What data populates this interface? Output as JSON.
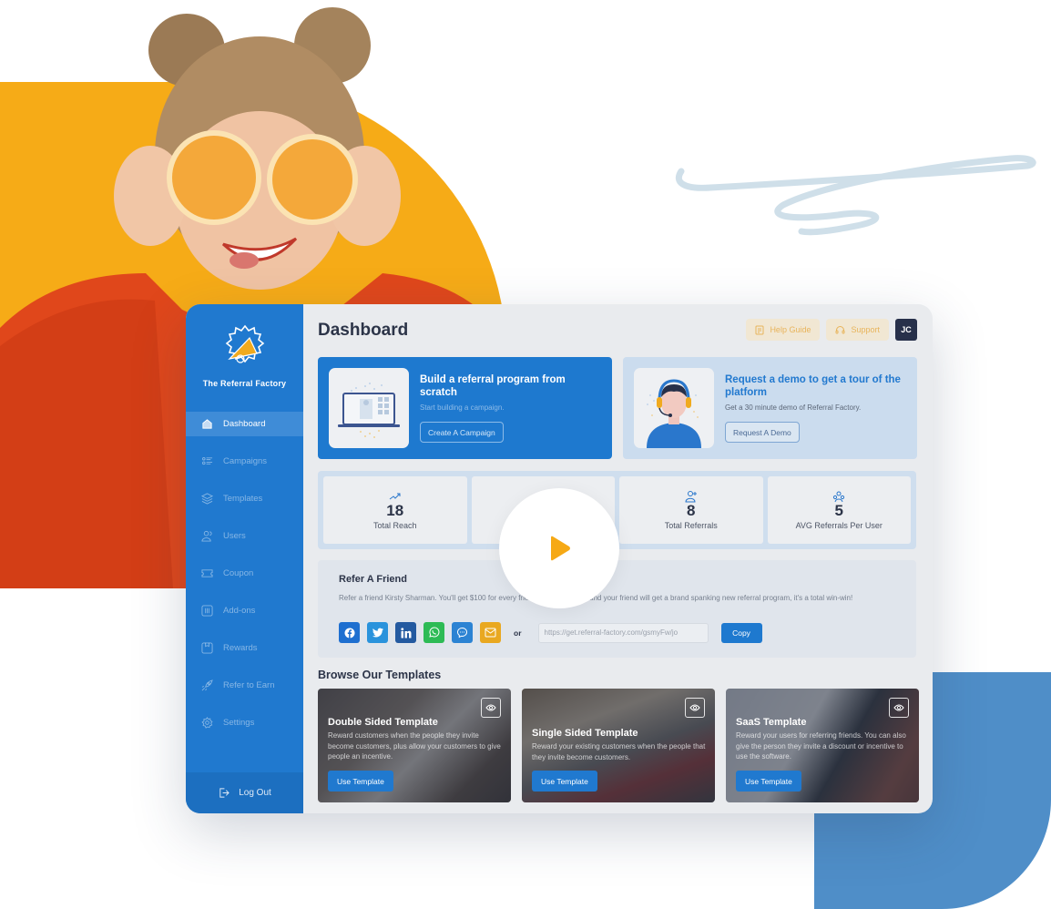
{
  "brand": {
    "name": "The Referral Factory",
    "accent_blue": "#2079cf",
    "accent_orange": "#f6ab17",
    "dark_navy": "#2c3448"
  },
  "sidebar": {
    "items": [
      {
        "label": "Dashboard",
        "icon": "home-icon",
        "active": true
      },
      {
        "label": "Campaigns",
        "icon": "list-icon",
        "active": false
      },
      {
        "label": "Templates",
        "icon": "layers-icon",
        "active": false
      },
      {
        "label": "Users",
        "icon": "users-icon",
        "active": false
      },
      {
        "label": "Coupon",
        "icon": "ticket-icon",
        "active": false
      },
      {
        "label": "Add-ons",
        "icon": "addons-icon",
        "active": false
      },
      {
        "label": "Rewards",
        "icon": "gift-box-icon",
        "active": false
      },
      {
        "label": "Refer to Earn",
        "icon": "rocket-icon",
        "active": false
      },
      {
        "label": "Settings",
        "icon": "gear-icon",
        "active": false
      }
    ],
    "logout_label": "Log Out"
  },
  "header": {
    "title": "Dashboard",
    "help_guide_label": "Help Guide",
    "support_label": "Support",
    "avatar_initials": "JC"
  },
  "promos": {
    "build": {
      "title": "Build a referral program from scratch",
      "subtitle": "Start building a campaign.",
      "button": "Create A Campaign"
    },
    "demo": {
      "title": "Request a demo to get a tour of the platform",
      "subtitle": "Get a 30 minute demo of Referral Factory.",
      "button": "Request A Demo"
    }
  },
  "stats": [
    {
      "value": "18",
      "label": "Total Reach",
      "icon": "trending-up-icon"
    },
    {
      "value": "",
      "label": "",
      "icon": "user-icon"
    },
    {
      "value": "8",
      "label": "Total Referrals",
      "icon": "user-plus-icon"
    },
    {
      "value": "5",
      "label": "AVG Referrals Per User",
      "icon": "users-group-icon"
    }
  ],
  "refer": {
    "title": "Refer A Friend",
    "text": "Refer a friend Kirsty Sharman. You'll get $100 for every friend you refer to us, and your friend will get a brand spanking new referral program, it's a total win-win!",
    "share_buttons": [
      {
        "name": "facebook",
        "color": "#1e6fd0"
      },
      {
        "name": "twitter",
        "color": "#2a93dc"
      },
      {
        "name": "linkedin",
        "color": "#245aa0"
      },
      {
        "name": "whatsapp",
        "color": "#2dbb55"
      },
      {
        "name": "messenger",
        "color": "#2c83d3"
      },
      {
        "name": "email",
        "color": "#e9a820"
      }
    ],
    "or_label": "or",
    "link_value": "https://get.referral-factory.com/gsmyFw/jo",
    "copy_label": "Copy"
  },
  "templates": {
    "section_title": "Browse Our Templates",
    "items": [
      {
        "title": "Double Sided Template",
        "description": "Reward customers when the people they invite become customers, plus allow your customers to give people an incentive.",
        "button": "Use Template"
      },
      {
        "title": "Single Sided Template",
        "description": "Reward your existing customers when the people that they invite become customers.",
        "button": "Use Template"
      },
      {
        "title": "SaaS Template",
        "description": "Reward your users for referring friends. You can also give the person they invite a discount or incentive to use the software.",
        "button": "Use Template"
      }
    ]
  }
}
